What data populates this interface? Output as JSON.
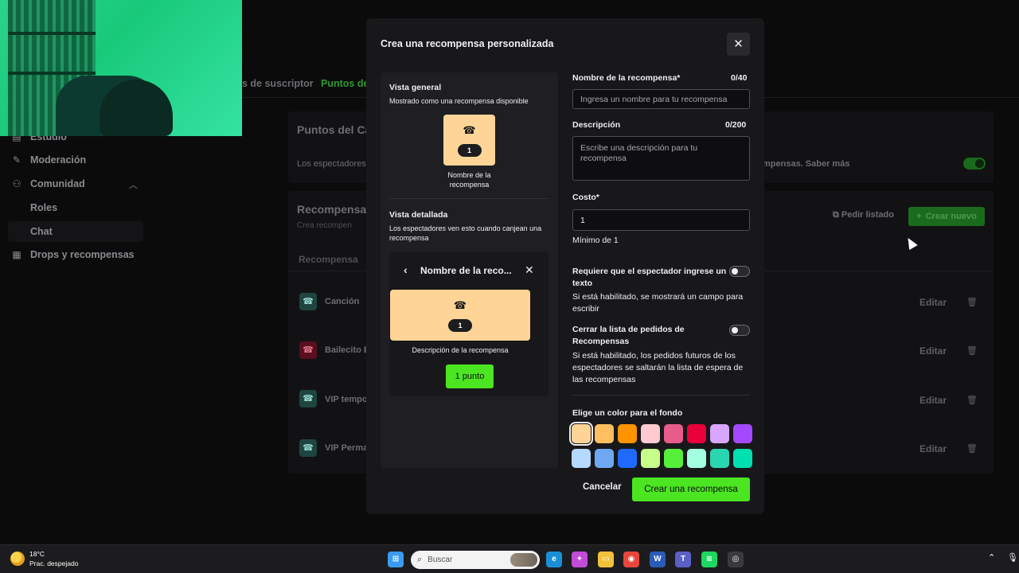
{
  "background": {
    "sidebar": {
      "items": [
        {
          "label": "Estudio",
          "icon": "studio-icon"
        },
        {
          "label": "Moderación",
          "icon": "wrench-icon"
        },
        {
          "label": "Comunidad",
          "icon": "community-icon"
        },
        {
          "label": "Drops y recompensas",
          "icon": "gift-icon"
        }
      ],
      "subitems": [
        "Roles",
        "Chat"
      ]
    },
    "tabs": [
      "s de suscriptor",
      "Puntos de"
    ],
    "channel_points_card": {
      "title": "Puntos del Ca",
      "description_left": "Los espectadores",
      "description_right": "mpensas. Saber más"
    },
    "rewards_card": {
      "title": "Recompensas",
      "subtitle": "Crea recompen",
      "request_list": "Pedir listado",
      "create_new": "Crear nuevo",
      "column_header": "Recompensa",
      "rows": [
        {
          "name": "Canción",
          "edit": "Editar"
        },
        {
          "name": "Bailecito E",
          "edit": "Editar"
        },
        {
          "name": "VIP tempo",
          "edit": "Editar"
        },
        {
          "name": "VIP Perma",
          "edit": "Editar"
        }
      ]
    }
  },
  "modal": {
    "title": "Crea una recompensa personalizada",
    "preview": {
      "overview_title": "Vista general",
      "overview_subtitle": "Mostrado como una recompensa disponible",
      "tile_cost": "1",
      "tile_caption": "Nombre de la recompensa",
      "detail_title": "Vista detallada",
      "detail_subtitle": "Los espectadores ven esto cuando canjean una recompensa",
      "detail_name": "Nombre de la reco...",
      "detail_cost": "1",
      "detail_description": "Descripción de la recompensa",
      "points_button": "1 punto"
    },
    "form": {
      "name_label": "Nombre de la recompensa*",
      "name_count": "0/40",
      "name_placeholder": "Ingresa un nombre para tu recompensa",
      "description_label": "Descripción",
      "description_count": "0/200",
      "description_placeholder": "Escribe una descripción para tu recompensa",
      "cost_label": "Costo*",
      "cost_value": "1",
      "cost_hint": "Mínimo de 1",
      "require_text_label": "Requiere que el espectador ingrese un texto",
      "require_text_hint": "Si está habilitado, se mostrará un campo para escribir",
      "require_text_enabled": false,
      "skip_queue_label": "Cerrar la lista de pedidos de Recompensas",
      "skip_queue_hint": "Si está habilitado, los pedidos futuros de los espectadores se saltarán la lista de espera de las recompensas",
      "skip_queue_enabled": false,
      "color_label": "Elige un color para el fondo",
      "colors": [
        "#ffd597",
        "#ffbf60",
        "#ff9300",
        "#ffcad1",
        "#e75c8a",
        "#e9003a",
        "#d9a6ff",
        "#a449ff",
        "#b6d9ff",
        "#6fa8f2",
        "#1f69ff",
        "#c6ff8a",
        "#56ef3a",
        "#a3ffe0",
        "#2ad6b0",
        "#00e0b0"
      ],
      "selected_color": "#ffd597",
      "cancel_label": "Cancelar",
      "submit_label": "Crear una recompensa"
    }
  },
  "taskbar": {
    "temperature": "18°C",
    "weather": "Prac. despejado",
    "search_placeholder": "Buscar",
    "apps": [
      {
        "icon": "windows-start-icon",
        "color": "#3a9bf0"
      },
      {
        "icon": "edge-icon",
        "color": "#1b8fd6"
      },
      {
        "icon": "copilot-icon",
        "color": "#c34bd6"
      },
      {
        "icon": "file-explorer-icon",
        "color": "#f2c23a"
      },
      {
        "icon": "chrome-icon",
        "color": "#e8453c"
      },
      {
        "icon": "word-icon",
        "color": "#2b5bb8"
      },
      {
        "icon": "teams-icon",
        "color": "#5b5fc7"
      },
      {
        "icon": "spotify-icon",
        "color": "#1ed760"
      },
      {
        "icon": "obs-icon",
        "color": "#3a3a3d"
      }
    ]
  }
}
